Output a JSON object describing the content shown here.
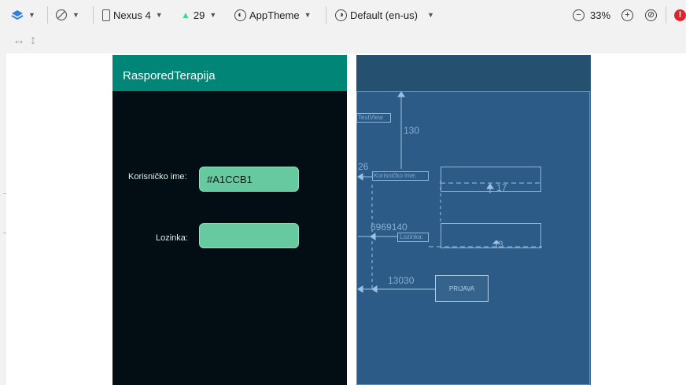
{
  "toolbar": {
    "device": "Nexus 4",
    "api_level": "29",
    "theme": "AppTheme",
    "locale": "Default (en-us)",
    "zoom": "33%"
  },
  "design": {
    "app_title": "RasporedTerapija",
    "username_label": "Korisničko ime:",
    "username_value": "#A1CCB1",
    "password_label": "Lozinka:",
    "password_value": ""
  },
  "blueprint": {
    "textview_label": "TextView",
    "username_label": "Korisničko ime:",
    "password_label": "Lozinka:",
    "button_label": "PRIJAVA",
    "dim_130": "130",
    "dim_26": "26",
    "dim_17": "17",
    "dim_69_140": "6969140",
    "dim_3": "3",
    "dim_130_btn": "13030"
  },
  "colors": {
    "appbar": "#008577",
    "design_bg": "#030d14",
    "edit_fill": "#66c9a0",
    "blueprint_bg": "#2b5b86"
  },
  "icons": [
    "layers-icon",
    "rotate-icon",
    "device-icon",
    "android-api-icon",
    "theme-icon",
    "globe-icon",
    "zoom-out-icon",
    "zoom-in-icon",
    "zoom-fit-icon",
    "error-icon",
    "horizontal-resize-icon",
    "vertical-resize-icon"
  ]
}
